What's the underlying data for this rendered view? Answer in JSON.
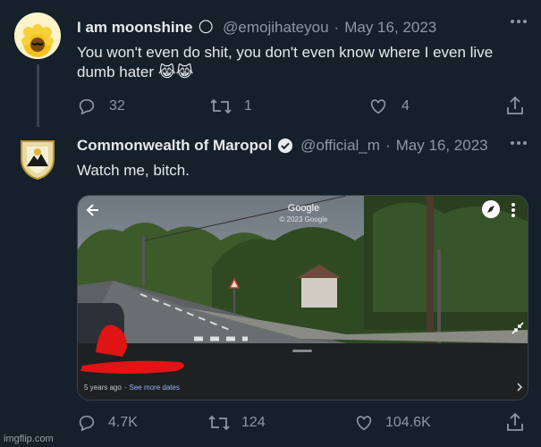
{
  "tweet1": {
    "display_name": "I am moonshine",
    "name_emoji": "🌕",
    "handle": "@emojihateyou",
    "separator": "·",
    "date": "May 16, 2023",
    "text_line1": "You won't even do shit, you don't even know where I even live",
    "text_line2": "dumb hater",
    "text_emojis": "😹😹",
    "replies": "32",
    "retweets": "1",
    "likes": "4"
  },
  "tweet2": {
    "display_name": "Commonwealth of Maropol",
    "handle": "@official_m",
    "separator": "·",
    "date": "May 16, 2023",
    "text": "Watch me, bitch.",
    "replies": "4.7K",
    "retweets": "124",
    "likes": "104.6K",
    "verified_color": "#e7e9ea"
  },
  "street_view": {
    "provider": "Google",
    "copyright": "© 2023 Google",
    "age": "5 years ago",
    "dot": "·",
    "see_more": "See more dates",
    "link_color": "#8ab4f8"
  },
  "watermark": "imgflip.com",
  "icons": {
    "more": "more-icon",
    "reply": "reply-icon",
    "retweet": "retweet-icon",
    "like": "heart-icon",
    "share": "share-icon",
    "back": "back-arrow-icon",
    "compass": "compass-icon",
    "collapse": "collapse-icon",
    "chevron": "chevron-right-icon"
  }
}
